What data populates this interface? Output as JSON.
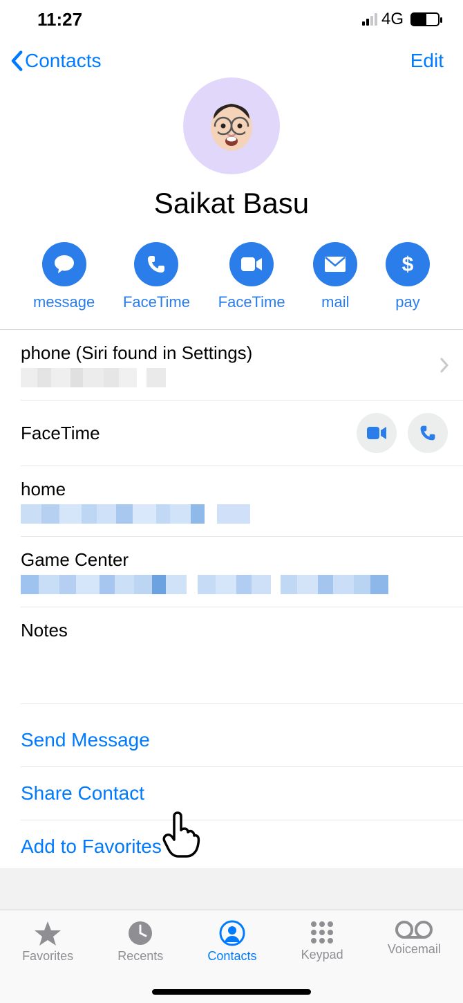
{
  "status": {
    "time": "11:27",
    "network": "4G"
  },
  "nav": {
    "back_label": "Contacts",
    "edit_label": "Edit"
  },
  "contact": {
    "name": "Saikat Basu"
  },
  "actions": {
    "message": "message",
    "facetime_video": "FaceTime",
    "facetime_audio": "FaceTime",
    "mail": "mail",
    "pay": "pay"
  },
  "details": {
    "phone_label": "phone (Siri found in Settings)",
    "facetime_label": "FaceTime",
    "home_label": "home",
    "gamecenter_label": "Game Center",
    "notes_label": "Notes"
  },
  "links": {
    "send_message": "Send Message",
    "share_contact": "Share Contact",
    "add_favorites": "Add to Favorites"
  },
  "tabs": {
    "favorites": "Favorites",
    "recents": "Recents",
    "contacts": "Contacts",
    "keypad": "Keypad",
    "voicemail": "Voicemail"
  }
}
